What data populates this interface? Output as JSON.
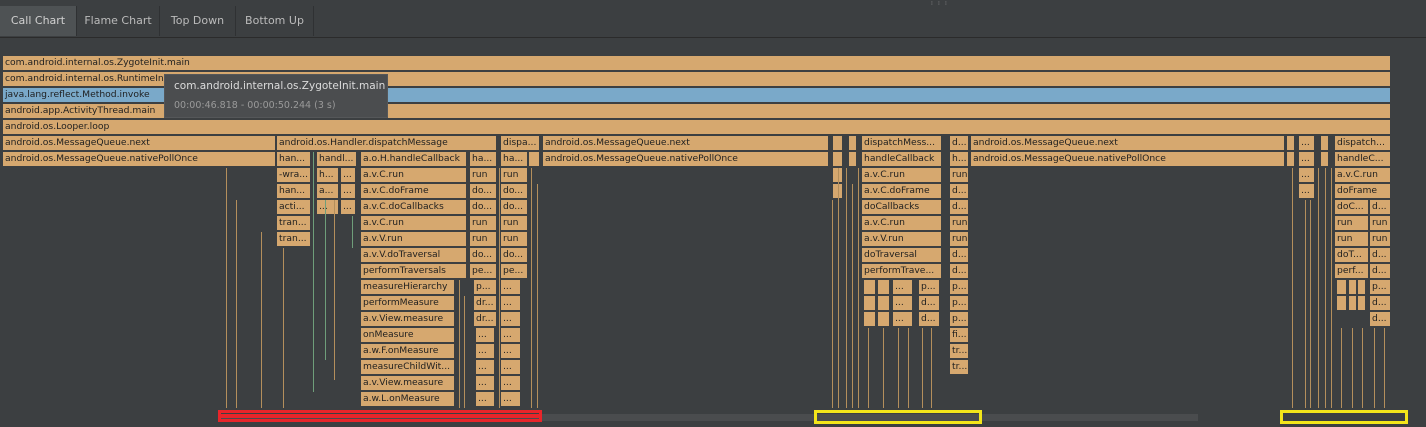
{
  "tabs": [
    {
      "label": "Call Chart",
      "selected": true
    },
    {
      "label": "Flame Chart",
      "selected": false
    },
    {
      "label": "Top Down",
      "selected": false
    },
    {
      "label": "Bottom Up",
      "selected": false
    }
  ],
  "colors": {
    "bar": "#d6a86f",
    "selected_bar": "#7aa9c9",
    "highlight_red": "#e8252a",
    "highlight_yellow": "#f3e51a"
  },
  "stack": {
    "zygote": "com.android.internal.os.ZygoteInit.main",
    "runtimeinit": "com.android.internal.os.RuntimeInit",
    "invoke": "java.lang.reflect.Method.invoke",
    "activitythread": "android.app.ActivityThread.main",
    "looper": "android.os.Looper.loop",
    "mq_next": "android.os.MessageQueue.next",
    "mq_native": "android.os.MessageQueue.nativePollOnce",
    "dispatch": "android.os.Handler.dispatchMessage",
    "dispa": "dispa...",
    "dispatch2": "dispatchMess...",
    "dispatch3": "dispatch...",
    "d": "d...",
    "han": "han...",
    "handl": "handl...",
    "aoh": "a.o.H.handleCallback",
    "ha": "ha...",
    "handlecallback": "handleCallback",
    "h": "h...",
    "handlec": "handleC...",
    "wra": "-wra...",
    "h2": "h...",
    "run": "run",
    "avcrun": "a.v.C.run",
    "a": "a...",
    "avcdoframe": "a.v.C.doFrame",
    "do": "do...",
    "doframe": "doFrame",
    "acti": "acti...",
    "avcdocallbacks": "a.v.C.doCallbacks",
    "docallbacks": "doCallbacks",
    "doc": "doC...",
    "tran": "tran...",
    "avvrun": "a.v.V.run",
    "avvdotraversal": "a.v.V.doTraversal",
    "dotraversal": "doTraversal",
    "dot": "doT...",
    "performtraversals": "performTraversals",
    "pe": "pe...",
    "performtrave": "performTrave...",
    "perf": "perf...",
    "measurehierarchy": "measureHierarchy",
    "p": "p...",
    "ellipsis": "...",
    "performmeasure": "performMeasure",
    "dr": "dr...",
    "avviewmeasure": "a.v.View.measure",
    "onmeasure": "onMeasure",
    "fi": "fi...",
    "awfonmeasure": "a.w.F.onMeasure",
    "tr": "tr...",
    "measurechildwit": "measureChildWit...",
    "awlonmeasure": "a.w.L.onMeasure"
  },
  "tooltip": {
    "title": "com.android.internal.os.ZygoteInit.main",
    "range": "00:00:46.818 - 00:00:50.244 (3 s)"
  }
}
